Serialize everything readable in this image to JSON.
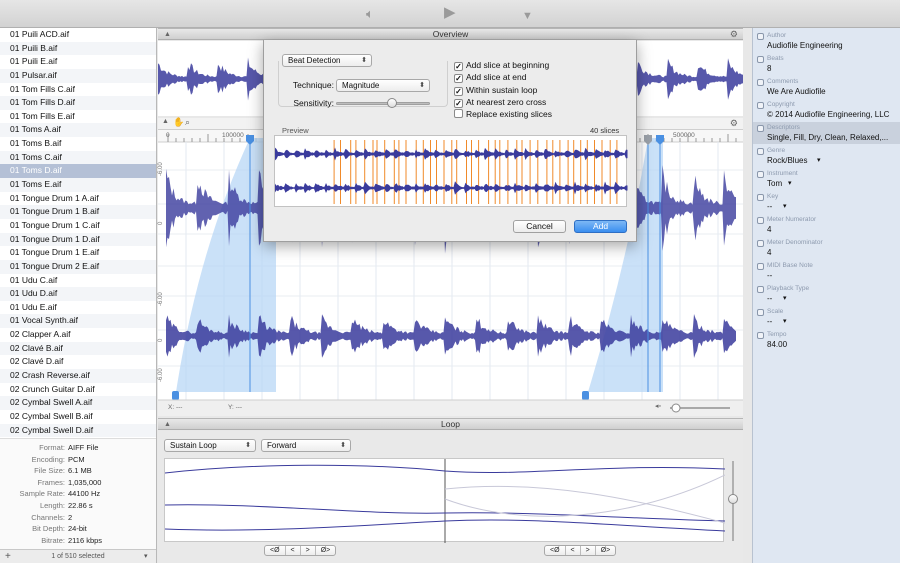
{
  "toolbar": {
    "volume_icon": "speaker-icon",
    "play_icon": "play-icon",
    "download_icon": "download-icon"
  },
  "files": [
    "01 Puili ACD.aif",
    "01 Puili B.aif",
    "01 Puili E.aif",
    "01 Pulsar.aif",
    "01 Tom Fills C.aif",
    "01 Tom Fills D.aif",
    "01 Tom Fills E.aif",
    "01 Toms A.aif",
    "01 Toms B.aif",
    "01 Toms C.aif",
    "01 Toms D.aif",
    "01 Toms E.aif",
    "01 Tongue Drum 1 A.aif",
    "01 Tongue Drum 1 B.aif",
    "01 Tongue Drum 1 C.aif",
    "01 Tongue Drum 1 D.aif",
    "01 Tongue Drum 1 E.aif",
    "01 Tongue Drum 2 E.aif",
    "01 Udu C.aif",
    "01 Udu D.aif",
    "01 Udu E.aif",
    "01 Vocal Synth.aif",
    "02 Clapper A.aif",
    "02 Clavé B.aif",
    "02 Clavé D.aif",
    "02 Crash Reverse.aif",
    "02 Crunch Guitar D.aif",
    "02 Cymbal Swell A.aif",
    "02 Cymbal Swell B.aif",
    "02 Cymbal Swell D.aif"
  ],
  "selected_file_index": 10,
  "file_info": [
    {
      "label": "Format:",
      "value": "AIFF File"
    },
    {
      "label": "Encoding:",
      "value": "PCM"
    },
    {
      "label": "File Size:",
      "value": "6.1 MB"
    },
    {
      "label": "Frames:",
      "value": "1,035,000"
    },
    {
      "label": "Sample Rate:",
      "value": "44100 Hz"
    },
    {
      "label": "Length:",
      "value": "22.86 s"
    },
    {
      "label": "Channels:",
      "value": "2"
    },
    {
      "label": "Bit Depth:",
      "value": "24-bit"
    },
    {
      "label": "Bitrate:",
      "value": "2116 kbps"
    }
  ],
  "sidebar_footer": {
    "add": "+",
    "status": "1 of 510 selected",
    "menu": "▾"
  },
  "overview": {
    "title": "Overview"
  },
  "editor": {
    "ruler": [
      "0",
      "100000",
      "500000"
    ],
    "db_labels": [
      "-6.00",
      "0",
      "-6.00",
      "0",
      "-6.00"
    ],
    "x_readout": "X: ---",
    "y_readout": "Y: ---",
    "zoom": 0.1
  },
  "loop": {
    "title": "Loop",
    "mode": "Sustain Loop",
    "direction": "Forward",
    "nav_left": [
      "<Ø",
      "<",
      ">",
      "Ø>"
    ],
    "nav_right": [
      "<Ø",
      "<",
      ">",
      "Ø>"
    ]
  },
  "dialog": {
    "mode": "Beat Detection",
    "technique_label": "Technique:",
    "technique": "Magnitude",
    "sensitivity_label": "Sensitivity:",
    "sensitivity": 0.6,
    "options": [
      {
        "label": "Add slice at beginning",
        "checked": true
      },
      {
        "label": "Add slice at end",
        "checked": true
      },
      {
        "label": "Within sustain loop",
        "checked": true
      },
      {
        "label": "At nearest zero cross",
        "checked": true
      },
      {
        "label": "Replace existing slices",
        "checked": false
      }
    ],
    "preview_label": "Preview",
    "slice_count": "40 slices",
    "cancel": "Cancel",
    "add": "Add"
  },
  "inspector": [
    {
      "label": "Author",
      "value": "Audiofile Engineering"
    },
    {
      "label": "Beats",
      "value": "8"
    },
    {
      "label": "Comments",
      "value": "We Are Audiofile"
    },
    {
      "label": "Copyright",
      "value": "© 2014 Audiofile Engineering, LLC"
    },
    {
      "label": "Descriptors",
      "value": "Single, Fill, Dry, Clean, Relaxed,..."
    },
    {
      "label": "Genre",
      "value": "Rock/Blues"
    },
    {
      "label": "Instrument",
      "value": "Tom"
    },
    {
      "label": "Key",
      "value": "--"
    },
    {
      "label": "Meter Numerator",
      "value": "4"
    },
    {
      "label": "Meter Denominator",
      "value": "4"
    },
    {
      "label": "MIDI Base Note",
      "value": "--"
    },
    {
      "label": "Playback Type",
      "value": "--"
    },
    {
      "label": "Scale",
      "value": "--"
    },
    {
      "label": "Tempo",
      "value": "84.00"
    }
  ],
  "colors": {
    "waveform": "#3a3b9c",
    "slice_marker": "#f08a2a",
    "loop_region": "#b8d7f5",
    "accent": "#3a8ef0"
  }
}
